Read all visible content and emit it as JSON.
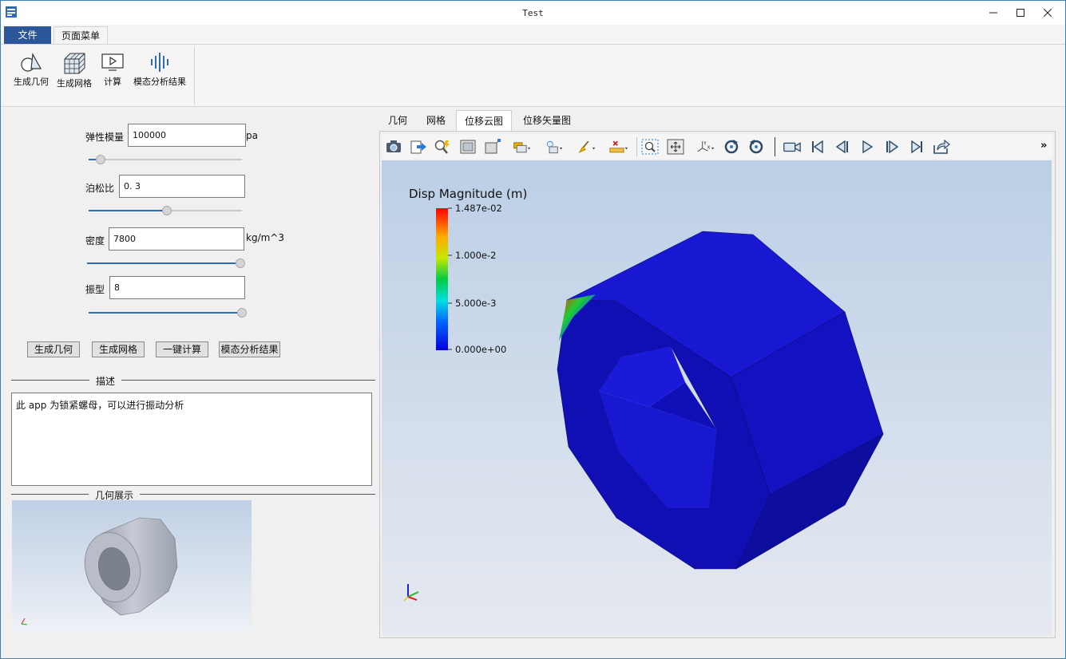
{
  "window": {
    "title": "Test"
  },
  "ribbon": {
    "tabs": [
      "文件",
      "页面菜单"
    ],
    "buttons": [
      "生成几何",
      "生成网格",
      "计算",
      "模态分析结果"
    ]
  },
  "form": {
    "elastic_modulus": {
      "label": "弹性模量",
      "value": "100000",
      "unit": "pa",
      "slider_fraction": 0.08
    },
    "poisson_ratio": {
      "label": "泊松比",
      "value": "0. 3",
      "slider_fraction": 0.51
    },
    "density": {
      "label": "密度",
      "value": "7800",
      "unit": "kg/m^3",
      "slider_fraction": 1.0
    },
    "mode_shape": {
      "label": "振型",
      "value": "8",
      "slider_fraction": 1.0
    }
  },
  "actions": [
    "生成几何",
    "生成网格",
    "一键计算",
    "模态分析结果"
  ],
  "description": {
    "group_title": "描述",
    "text": "此 app 为锁紧螺母，可以进行振动分析"
  },
  "geometry_preview": {
    "group_title": "几何展示"
  },
  "viewer": {
    "tabs": [
      "几何",
      "网格",
      "位移云图",
      "位移矢量图"
    ],
    "active_tab": "位移云图",
    "overflow_label": "»",
    "toolbar_icons": [
      "camera-icon",
      "export-icon",
      "zoom-query-icon",
      "frame-icon",
      "box-icon",
      "layer-icon",
      "light-icon",
      "brush-icon",
      "ruler-icon",
      "zoom-region-icon",
      "fit-icon",
      "axes-icon",
      "rotate-cw-icon",
      "rotate-ccw-icon",
      "video-icon",
      "first-frame-icon",
      "prev-frame-icon",
      "play-icon",
      "next-frame-icon",
      "last-frame-icon",
      "export-anim-icon"
    ],
    "legend": {
      "title": "Disp Magnitude (m)",
      "ticks": [
        "1.487e-02",
        "1.000e-2",
        "5.000e-3",
        "0.000e+00"
      ]
    }
  },
  "colors": {
    "file_tab": "#2b579a",
    "slider_fill": "#2b6cb5",
    "mesh_blue": "#1414c8"
  }
}
